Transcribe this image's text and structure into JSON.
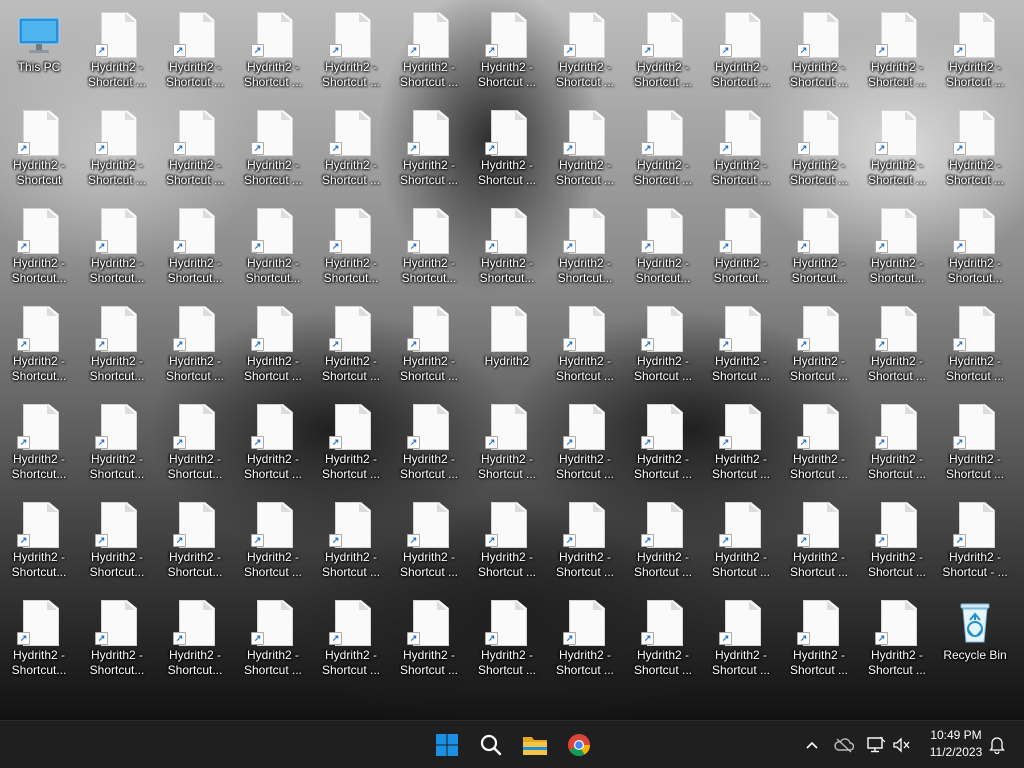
{
  "desktop": {
    "this_pc_label": "This PC",
    "recycle_bin_label": "Recycle Bin",
    "short_label": "Hydrith2 - Shortcut",
    "short_label_trunc": "Hydrith2 - Shortcut...",
    "spaced_label_trunc": "Hydrith2 - Shortcut ...",
    "plain_label": "Hydrith2",
    "dash_label": "Hydrith2 - Shortcut - ..."
  },
  "taskbar": {
    "time": "10:49 PM",
    "date": "11/2/2023",
    "apps": [
      "start-button",
      "search-button",
      "file-explorer",
      "chrome"
    ]
  },
  "colors": {
    "taskbar_bg": "#1f1f1f",
    "start_blue": "#0f6cbd",
    "folder_yellow": "#f4c542"
  }
}
